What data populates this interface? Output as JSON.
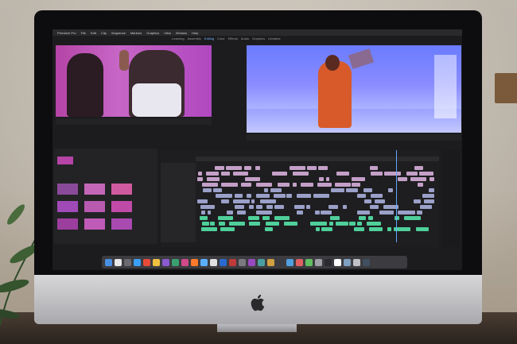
{
  "menubar": {
    "app": "Premiere Pro",
    "items": [
      "File",
      "Edit",
      "Clip",
      "Sequence",
      "Markers",
      "Graphics",
      "View",
      "Window",
      "Help"
    ]
  },
  "workspaces": [
    "Learning",
    "Assembly",
    "Editing",
    "Color",
    "Effects",
    "Audio",
    "Graphics",
    "Libraries"
  ],
  "active_workspace": "Editing",
  "colors": {
    "accent": "#6fb0ff",
    "source_bg": "#b544a6",
    "program_bg": "#7a88ff",
    "clip_video": "#9aa0c8",
    "clip_audio": "#4fcf9a"
  }
}
